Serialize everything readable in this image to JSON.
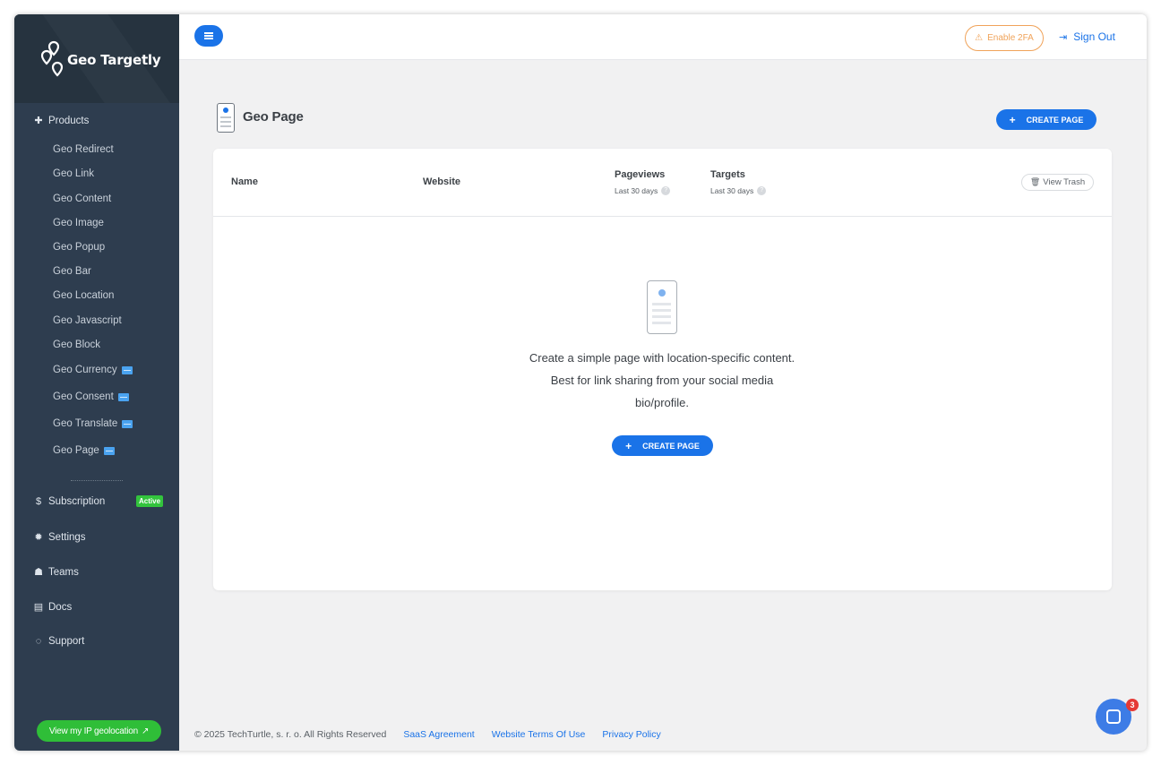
{
  "brand": {
    "name": "Geo Targetly"
  },
  "sidebar": {
    "products_label": "Products",
    "products": [
      {
        "label": "Geo Redirect",
        "new": false
      },
      {
        "label": "Geo Link",
        "new": false
      },
      {
        "label": "Geo Content",
        "new": false
      },
      {
        "label": "Geo Image",
        "new": false
      },
      {
        "label": "Geo Popup",
        "new": false
      },
      {
        "label": "Geo Bar",
        "new": false
      },
      {
        "label": "Geo Location",
        "new": false
      },
      {
        "label": "Geo Javascript",
        "new": false
      },
      {
        "label": "Geo Block",
        "new": false
      },
      {
        "label": "Geo Currency",
        "new": true
      },
      {
        "label": "Geo Consent",
        "new": true
      },
      {
        "label": "Geo Translate",
        "new": true
      },
      {
        "label": "Geo Page",
        "new": true
      }
    ],
    "subscription_label": "Subscription",
    "subscription_status": "Active",
    "settings_label": "Settings",
    "teams_label": "Teams",
    "docs_label": "Docs",
    "support_label": "Support",
    "geo_button_label": "View my IP geolocation"
  },
  "topbar": {
    "enable_2fa_label": "Enable 2FA",
    "sign_out_label": "Sign Out"
  },
  "page": {
    "title": "Geo Page",
    "create_label": "CREATE PAGE"
  },
  "table": {
    "col_name": "Name",
    "col_website": "Website",
    "col_pageviews": "Pageviews",
    "col_pageviews_sub": "Last 30 days",
    "col_targets": "Targets",
    "col_targets_sub": "Last 30 days",
    "view_trash_label": "View Trash"
  },
  "empty_state": {
    "line1": "Create a simple page with location-specific content.",
    "line2": "Best for link sharing from your social media",
    "line3": "bio/profile.",
    "create_label": "CREATE PAGE"
  },
  "footer": {
    "copyright": "© 2025 TechTurtle, s. r. o. All Rights Reserved",
    "link1": "SaaS Agreement",
    "link2": "Website Terms Of Use",
    "link3": "Privacy Policy"
  },
  "chat": {
    "badge_count": "3"
  },
  "colors": {
    "accent": "#1a73e8",
    "sidebar": "#2e3d4f",
    "active": "#33c43d",
    "warning": "#f0a35a"
  }
}
